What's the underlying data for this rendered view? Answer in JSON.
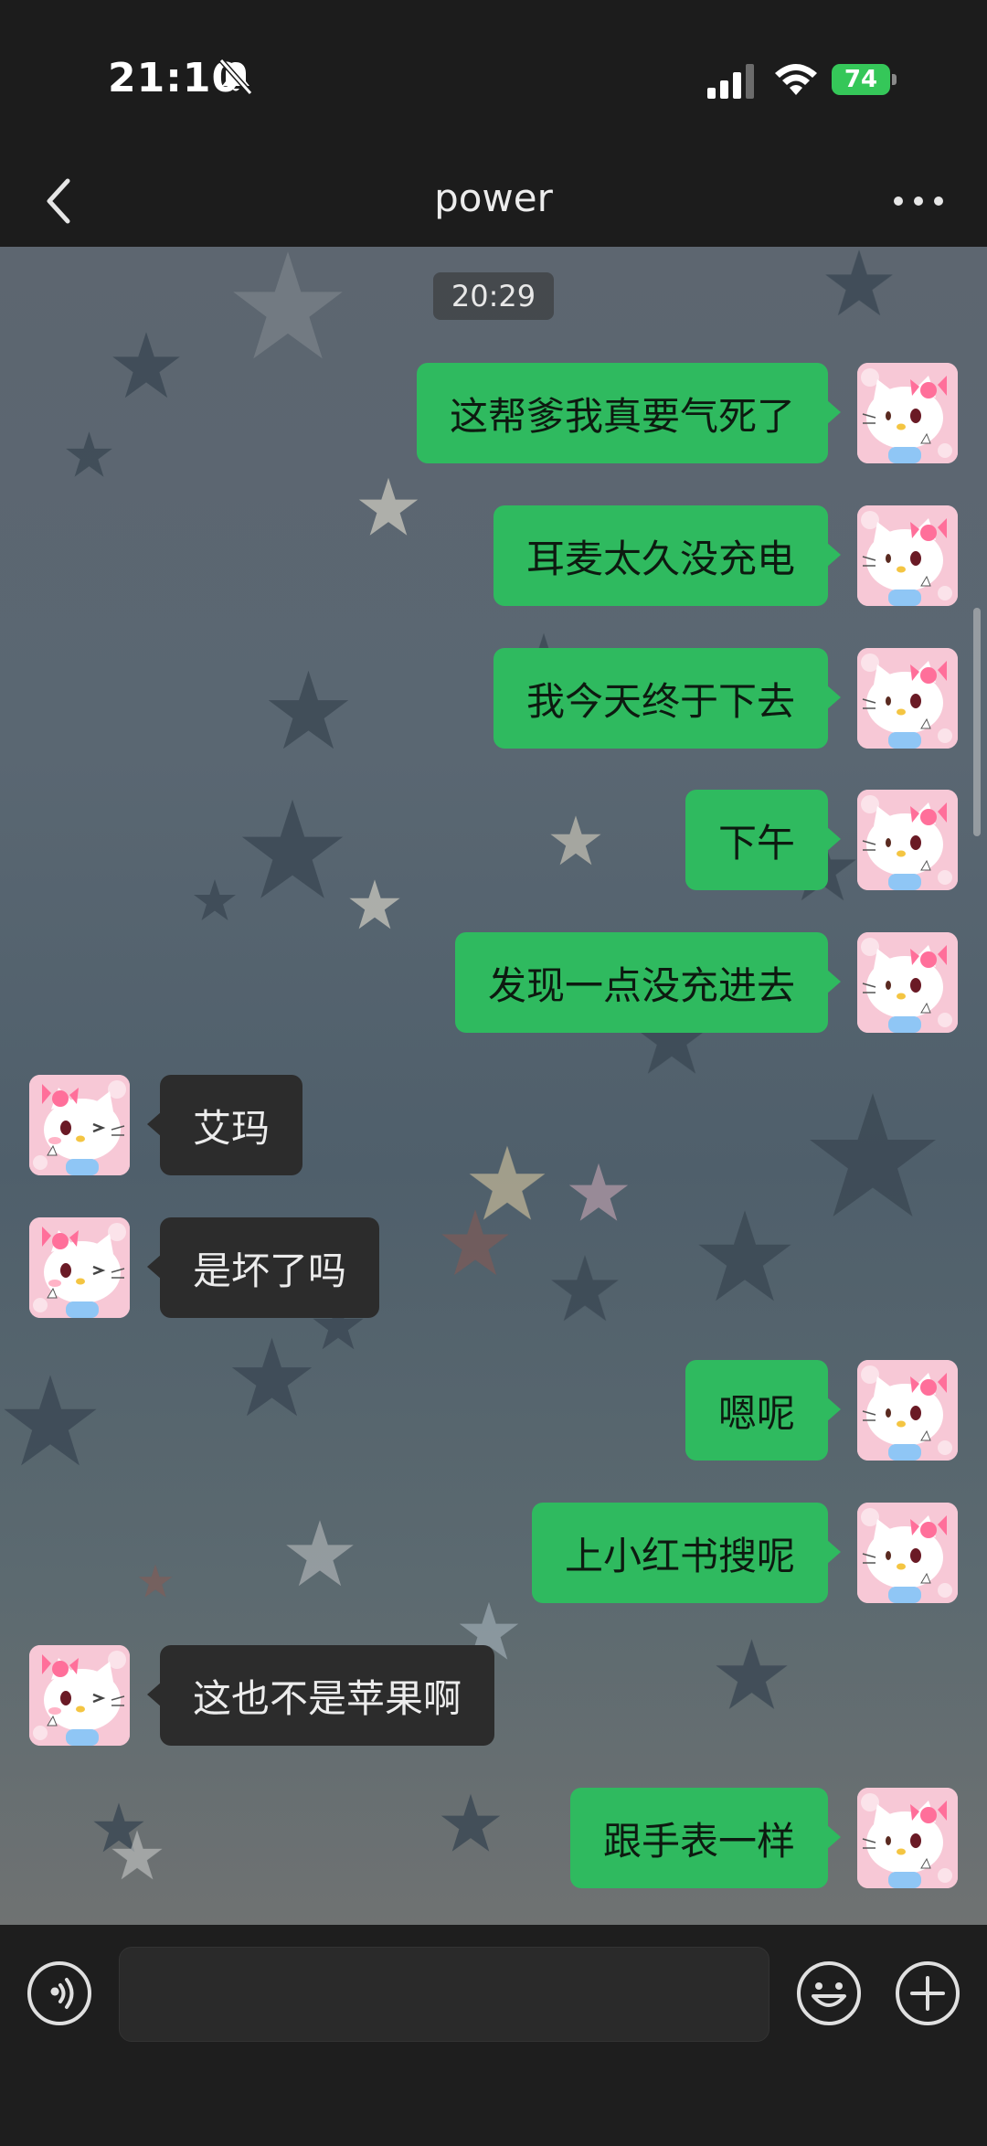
{
  "status_bar": {
    "time": "21:10",
    "battery": "74",
    "icons": [
      "bell-slash-icon",
      "signal-icon",
      "wifi-icon",
      "battery-icon"
    ]
  },
  "nav": {
    "title": "power",
    "back_icon": "chevron-left-icon",
    "more_icon": "ellipsis-icon"
  },
  "chat": {
    "timestamp": "20:29",
    "accent_colors": {
      "outgoing_bubble": "#2fba5f",
      "incoming_bubble": "#2c2c2c"
    },
    "messages": [
      {
        "side": "me",
        "text": "这帮爹我真要气死了"
      },
      {
        "side": "me",
        "text": "耳麦太久没充电"
      },
      {
        "side": "me",
        "text": "我今天终于下去"
      },
      {
        "side": "me",
        "text": "下午"
      },
      {
        "side": "me",
        "text": "发现一点没充进去"
      },
      {
        "side": "other",
        "text": "艾玛"
      },
      {
        "side": "other",
        "text": "是坏了吗"
      },
      {
        "side": "me",
        "text": "嗯呢"
      },
      {
        "side": "me",
        "text": "上小红书搜呢"
      },
      {
        "side": "other",
        "text": "这也不是苹果啊"
      },
      {
        "side": "me",
        "text": "跟手表一样"
      }
    ]
  },
  "input_bar": {
    "message_value": "",
    "icons": [
      "voice-icon",
      "emoji-icon",
      "plus-icon"
    ]
  }
}
